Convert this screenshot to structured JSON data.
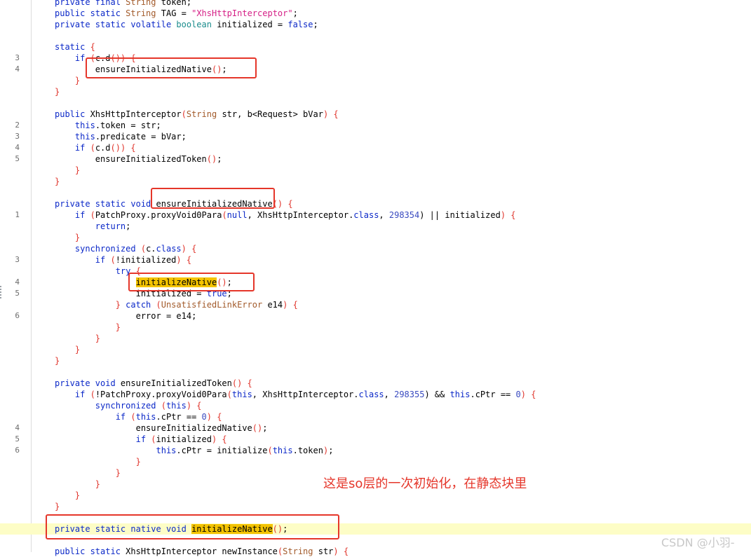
{
  "code_lines": [
    {
      "ln": "",
      "tokens": [
        {
          "t": "private final ",
          "c": "k"
        },
        {
          "t": "String",
          "c": "ty"
        },
        {
          "t": " token;"
        }
      ]
    },
    {
      "ln": "",
      "tokens": [
        {
          "t": "public static ",
          "c": "k"
        },
        {
          "t": "String",
          "c": "ty"
        },
        {
          "t": " TAG = "
        },
        {
          "t": "\"XhsHttpInterceptor\"",
          "c": "s"
        },
        {
          "t": ";"
        }
      ]
    },
    {
      "ln": "",
      "tokens": [
        {
          "t": "private static volatile ",
          "c": "k"
        },
        {
          "t": "boolean",
          "c": "bool"
        },
        {
          "t": " initialized = "
        },
        {
          "t": "false",
          "c": "k"
        },
        {
          "t": ";"
        }
      ]
    },
    {
      "ln": "",
      "tokens": []
    },
    {
      "ln": "",
      "tokens": [
        {
          "t": "static",
          "c": "k"
        },
        {
          "t": " {",
          "c": "p"
        }
      ]
    },
    {
      "ln": "3",
      "tokens": [
        {
          "t": "    "
        },
        {
          "t": "if",
          "c": "k"
        },
        {
          "t": " (",
          "c": "p"
        },
        {
          "t": "c.d"
        },
        {
          "t": "()) {",
          "c": "p"
        }
      ]
    },
    {
      "ln": "4",
      "tokens": [
        {
          "t": "        ensureInitializedNative"
        },
        {
          "t": "()",
          "c": "p"
        },
        {
          "t": ";"
        }
      ]
    },
    {
      "ln": "",
      "tokens": [
        {
          "t": "    "
        },
        {
          "t": "}",
          "c": "p"
        }
      ]
    },
    {
      "ln": "",
      "tokens": [
        {
          "t": "}",
          "c": "p"
        }
      ]
    },
    {
      "ln": "",
      "tokens": []
    },
    {
      "ln": "",
      "tokens": [
        {
          "t": "public ",
          "c": "k"
        },
        {
          "t": "XhsHttpInterceptor"
        },
        {
          "t": "(",
          "c": "p"
        },
        {
          "t": "String",
          "c": "ty"
        },
        {
          "t": " str, b<Request> bVar"
        },
        {
          "t": ") {",
          "c": "p"
        }
      ]
    },
    {
      "ln": "2",
      "tokens": [
        {
          "t": "    "
        },
        {
          "t": "this",
          "c": "k"
        },
        {
          "t": ".token = str;"
        }
      ]
    },
    {
      "ln": "3",
      "tokens": [
        {
          "t": "    "
        },
        {
          "t": "this",
          "c": "k"
        },
        {
          "t": ".predicate = bVar;"
        }
      ]
    },
    {
      "ln": "4",
      "tokens": [
        {
          "t": "    "
        },
        {
          "t": "if",
          "c": "k"
        },
        {
          "t": " (",
          "c": "p"
        },
        {
          "t": "c.d"
        },
        {
          "t": "()) {",
          "c": "p"
        }
      ]
    },
    {
      "ln": "5",
      "tokens": [
        {
          "t": "        ensureInitializedToken"
        },
        {
          "t": "()",
          "c": "p"
        },
        {
          "t": ";"
        }
      ]
    },
    {
      "ln": "",
      "tokens": [
        {
          "t": "    "
        },
        {
          "t": "}",
          "c": "p"
        }
      ]
    },
    {
      "ln": "",
      "tokens": [
        {
          "t": "}",
          "c": "p"
        }
      ]
    },
    {
      "ln": "",
      "tokens": []
    },
    {
      "ln": "",
      "tokens": [
        {
          "t": "private static void ",
          "c": "k"
        },
        {
          "t": "ensureInitializedNative"
        },
        {
          "t": "() {",
          "c": "p"
        }
      ]
    },
    {
      "ln": "1",
      "tokens": [
        {
          "t": "    "
        },
        {
          "t": "if",
          "c": "k"
        },
        {
          "t": " (",
          "c": "p"
        },
        {
          "t": "PatchProxy.proxyVoid0Para"
        },
        {
          "t": "(",
          "c": "p"
        },
        {
          "t": "null",
          "c": "k"
        },
        {
          "t": ", XhsHttpInterceptor."
        },
        {
          "t": "class",
          "c": "k"
        },
        {
          "t": ", "
        },
        {
          "t": "298354",
          "c": "n"
        },
        {
          "t": ") || initialized"
        },
        {
          "t": ") {",
          "c": "p"
        }
      ]
    },
    {
      "ln": "",
      "tokens": [
        {
          "t": "        "
        },
        {
          "t": "return",
          "c": "k"
        },
        {
          "t": ";"
        }
      ]
    },
    {
      "ln": "",
      "tokens": [
        {
          "t": "    "
        },
        {
          "t": "}",
          "c": "p"
        }
      ]
    },
    {
      "ln": "",
      "tokens": [
        {
          "t": "    "
        },
        {
          "t": "synchronized",
          "c": "k"
        },
        {
          "t": " (",
          "c": "p"
        },
        {
          "t": "c."
        },
        {
          "t": "class",
          "c": "k"
        },
        {
          "t": ") {",
          "c": "p"
        }
      ]
    },
    {
      "ln": "3",
      "tokens": [
        {
          "t": "        "
        },
        {
          "t": "if",
          "c": "k"
        },
        {
          "t": " (",
          "c": "p"
        },
        {
          "t": "!initialized"
        },
        {
          "t": ") {",
          "c": "p"
        }
      ]
    },
    {
      "ln": "",
      "tokens": [
        {
          "t": "            "
        },
        {
          "t": "try",
          "c": "k"
        },
        {
          "t": " {",
          "c": "p"
        }
      ]
    },
    {
      "ln": "4",
      "tokens": [
        {
          "t": "                "
        },
        {
          "t": "initializeNative",
          "c": "hlt"
        },
        {
          "t": "()",
          "c": "p"
        },
        {
          "t": ";"
        }
      ]
    },
    {
      "ln": "5",
      "tokens": [
        {
          "t": "                initialized = "
        },
        {
          "t": "true",
          "c": "k"
        },
        {
          "t": ";"
        }
      ]
    },
    {
      "ln": "",
      "tokens": [
        {
          "t": "            "
        },
        {
          "t": "} ",
          "c": "p"
        },
        {
          "t": "catch",
          "c": "k"
        },
        {
          "t": " (",
          "c": "p"
        },
        {
          "t": "UnsatisfiedLinkError",
          "c": "ty"
        },
        {
          "t": " e14"
        },
        {
          "t": ") {",
          "c": "p"
        }
      ]
    },
    {
      "ln": "6",
      "tokens": [
        {
          "t": "                error = e14;"
        }
      ]
    },
    {
      "ln": "",
      "tokens": [
        {
          "t": "            "
        },
        {
          "t": "}",
          "c": "p"
        }
      ]
    },
    {
      "ln": "",
      "tokens": [
        {
          "t": "        "
        },
        {
          "t": "}",
          "c": "p"
        }
      ]
    },
    {
      "ln": "",
      "tokens": [
        {
          "t": "    "
        },
        {
          "t": "}",
          "c": "p"
        }
      ]
    },
    {
      "ln": "",
      "tokens": [
        {
          "t": "}",
          "c": "p"
        }
      ]
    },
    {
      "ln": "",
      "tokens": []
    },
    {
      "ln": "",
      "tokens": [
        {
          "t": "private void ",
          "c": "k"
        },
        {
          "t": "ensureInitializedToken"
        },
        {
          "t": "() {",
          "c": "p"
        }
      ]
    },
    {
      "ln": "",
      "tokens": [
        {
          "t": "    "
        },
        {
          "t": "if",
          "c": "k"
        },
        {
          "t": " (",
          "c": "p"
        },
        {
          "t": "!PatchProxy.proxyVoid0Para"
        },
        {
          "t": "(",
          "c": "p"
        },
        {
          "t": "this",
          "c": "k"
        },
        {
          "t": ", XhsHttpInterceptor."
        },
        {
          "t": "class",
          "c": "k"
        },
        {
          "t": ", "
        },
        {
          "t": "298355",
          "c": "n"
        },
        {
          "t": ") && "
        },
        {
          "t": "this",
          "c": "k"
        },
        {
          "t": ".cPtr == "
        },
        {
          "t": "0",
          "c": "n"
        },
        {
          "t": ") {",
          "c": "p"
        }
      ]
    },
    {
      "ln": "",
      "tokens": [
        {
          "t": "        "
        },
        {
          "t": "synchronized",
          "c": "k"
        },
        {
          "t": " (",
          "c": "p"
        },
        {
          "t": "this",
          "c": "k"
        },
        {
          "t": ") {",
          "c": "p"
        }
      ]
    },
    {
      "ln": "",
      "tokens": [
        {
          "t": "            "
        },
        {
          "t": "if",
          "c": "k"
        },
        {
          "t": " (",
          "c": "p"
        },
        {
          "t": "this",
          "c": "k"
        },
        {
          "t": ".cPtr == "
        },
        {
          "t": "0",
          "c": "n"
        },
        {
          "t": ") {",
          "c": "p"
        }
      ]
    },
    {
      "ln": "4",
      "tokens": [
        {
          "t": "                ensureInitializedNative"
        },
        {
          "t": "()",
          "c": "p"
        },
        {
          "t": ";"
        }
      ]
    },
    {
      "ln": "5",
      "tokens": [
        {
          "t": "                "
        },
        {
          "t": "if",
          "c": "k"
        },
        {
          "t": " (",
          "c": "p"
        },
        {
          "t": "initialized"
        },
        {
          "t": ") {",
          "c": "p"
        }
      ]
    },
    {
      "ln": "6",
      "tokens": [
        {
          "t": "                    "
        },
        {
          "t": "this",
          "c": "k"
        },
        {
          "t": ".cPtr = initialize"
        },
        {
          "t": "(",
          "c": "p"
        },
        {
          "t": "this",
          "c": "k"
        },
        {
          "t": ".token"
        },
        {
          "t": ")",
          "c": "p"
        },
        {
          "t": ";"
        }
      ]
    },
    {
      "ln": "",
      "tokens": [
        {
          "t": "                "
        },
        {
          "t": "}",
          "c": "p"
        }
      ]
    },
    {
      "ln": "",
      "tokens": [
        {
          "t": "            "
        },
        {
          "t": "}",
          "c": "p"
        }
      ]
    },
    {
      "ln": "",
      "tokens": [
        {
          "t": "        "
        },
        {
          "t": "}",
          "c": "p"
        }
      ]
    },
    {
      "ln": "",
      "tokens": [
        {
          "t": "    "
        },
        {
          "t": "}",
          "c": "p"
        }
      ]
    },
    {
      "ln": "",
      "tokens": [
        {
          "t": "}",
          "c": "p"
        }
      ]
    },
    {
      "ln": "",
      "tokens": []
    },
    {
      "ln": "",
      "highlight": true,
      "tokens": [
        {
          "t": "private static native void ",
          "c": "k"
        },
        {
          "t": "initializeNative",
          "c": "sel"
        },
        {
          "t": "()",
          "c": "p"
        },
        {
          "t": ";"
        }
      ]
    },
    {
      "ln": "",
      "tokens": []
    },
    {
      "ln": "",
      "tokens": [
        {
          "t": "public static ",
          "c": "k"
        },
        {
          "t": "XhsHttpInterceptor newInstance"
        },
        {
          "t": "(",
          "c": "p"
        },
        {
          "t": "String",
          "c": "ty"
        },
        {
          "t": " str"
        },
        {
          "t": ") {",
          "c": "p"
        }
      ]
    }
  ],
  "annotation_text": "这是so层的一次初始化，在静态块里",
  "watermark_text": "CSDN @小羽-",
  "colors": {
    "keyword": "#0b28c8",
    "paren": "#e0342b",
    "string": "#d51f86",
    "type": "#a25a2a",
    "number": "#3a4bc0",
    "annotation_box": "#e5362a",
    "search_highlight": "#f5c400",
    "current_line": "#fdfdc6"
  }
}
